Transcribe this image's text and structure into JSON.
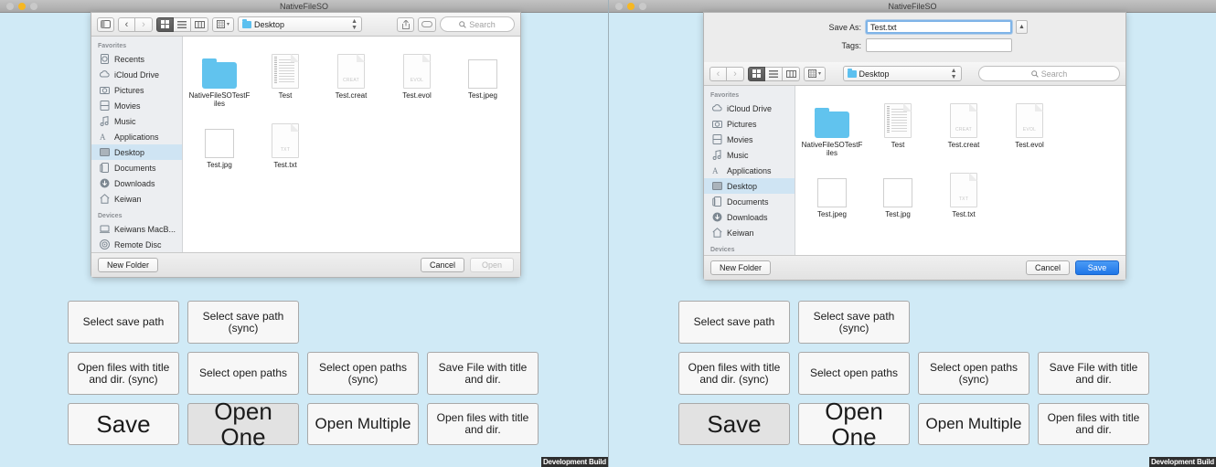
{
  "window_title": "NativeFileSO",
  "colors": {
    "background": "#d0eaf6",
    "accent": "#1f76e8",
    "selection": "#cfe4f3"
  },
  "traffic_lights": [
    "close",
    "minimize",
    "zoom"
  ],
  "watermark": "Development Build",
  "open_dialog": {
    "toolbar": {
      "sidebar_toggle": "sidebar-toggle-icon",
      "back": "‹",
      "forward": "›",
      "view_icon": "grid-view-icon",
      "view_list": "list-view-icon",
      "view_column": "column-view-icon",
      "group_by": "group-by-icon",
      "path_label": "Desktop",
      "share": "share-icon",
      "tag": "tag-icon",
      "search_placeholder": "Search"
    },
    "sidebar": {
      "favorites_header": "Favorites",
      "favorites": [
        {
          "label": "Recents",
          "icon": "clock-icon",
          "selected": false
        },
        {
          "label": "iCloud Drive",
          "icon": "cloud-icon",
          "selected": false
        },
        {
          "label": "Pictures",
          "icon": "camera-icon",
          "selected": false
        },
        {
          "label": "Movies",
          "icon": "film-icon",
          "selected": false
        },
        {
          "label": "Music",
          "icon": "note-icon",
          "selected": false
        },
        {
          "label": "Applications",
          "icon": "apps-icon",
          "selected": false
        },
        {
          "label": "Desktop",
          "icon": "desktop-icon",
          "selected": true
        },
        {
          "label": "Documents",
          "icon": "documents-icon",
          "selected": false
        },
        {
          "label": "Downloads",
          "icon": "download-icon",
          "selected": false
        },
        {
          "label": "Keiwan",
          "icon": "home-icon",
          "selected": false
        }
      ],
      "devices_header": "Devices",
      "devices": [
        {
          "label": "Keiwans MacB...",
          "icon": "laptop-icon"
        },
        {
          "label": "Remote Disc",
          "icon": "disc-icon"
        }
      ]
    },
    "files": [
      {
        "name": "NativeFileSOTestFiles",
        "type": "folder"
      },
      {
        "name": "Test",
        "type": "doc-lined"
      },
      {
        "name": "Test.creat",
        "type": "doc",
        "tag": "CREAT"
      },
      {
        "name": "Test.evol",
        "type": "doc",
        "tag": "EVOL"
      },
      {
        "name": "Test.jpeg",
        "type": "image",
        "bg": "#0a0a0a"
      },
      {
        "name": "Test.jpg",
        "type": "image",
        "bg": "#0a0a0a"
      },
      {
        "name": "Test.txt",
        "type": "doc",
        "tag": "TXT"
      }
    ],
    "footer": {
      "new_folder": "New Folder",
      "cancel": "Cancel",
      "confirm": "Open",
      "confirm_disabled": true
    }
  },
  "save_dialog": {
    "save_as_label": "Save As:",
    "save_as_value": "Test.txt",
    "tags_label": "Tags:",
    "tags_value": "",
    "toolbar": {
      "back": "‹",
      "forward": "›",
      "view_icon": "grid-view-icon",
      "view_list": "list-view-icon",
      "view_column": "column-view-icon",
      "group_by": "group-by-icon",
      "path_label": "Desktop",
      "search_placeholder": "Search"
    },
    "sidebar": {
      "favorites_header": "Favorites",
      "favorites": [
        {
          "label": "iCloud Drive",
          "icon": "cloud-icon",
          "selected": false
        },
        {
          "label": "Pictures",
          "icon": "camera-icon",
          "selected": false
        },
        {
          "label": "Movies",
          "icon": "film-icon",
          "selected": false
        },
        {
          "label": "Music",
          "icon": "note-icon",
          "selected": false
        },
        {
          "label": "Applications",
          "icon": "apps-icon",
          "selected": false
        },
        {
          "label": "Desktop",
          "icon": "desktop-icon",
          "selected": true
        },
        {
          "label": "Documents",
          "icon": "documents-icon",
          "selected": false
        },
        {
          "label": "Downloads",
          "icon": "download-icon",
          "selected": false
        },
        {
          "label": "Keiwan",
          "icon": "home-icon",
          "selected": false
        }
      ],
      "devices_header": "Devices",
      "devices": []
    },
    "files": [
      {
        "name": "NativeFileSOTestFiles",
        "type": "folder"
      },
      {
        "name": "Test",
        "type": "doc-lined"
      },
      {
        "name": "Test.creat",
        "type": "doc",
        "tag": "CREAT"
      },
      {
        "name": "Test.evol",
        "type": "doc",
        "tag": "EVOL"
      },
      {
        "name": "Test.jpeg",
        "type": "image",
        "bg": "#8e8e8e"
      },
      {
        "name": "Test.jpg",
        "type": "image",
        "bg": "#8e8e8e"
      },
      {
        "name": "Test.txt",
        "type": "doc",
        "tag": "TXT"
      }
    ],
    "footer": {
      "new_folder": "New Folder",
      "cancel": "Cancel",
      "confirm": "Save",
      "confirm_primary": true
    }
  },
  "app_buttons": {
    "left_highlight": "Open One",
    "right_highlight": "Save",
    "rows": [
      [
        {
          "label": "Select save path",
          "size": "normal"
        },
        {
          "label": "Select save path (sync)",
          "size": "normal"
        }
      ],
      [
        {
          "label": "Open files with title and dir. (sync)",
          "size": "normal"
        },
        {
          "label": "Select open paths",
          "size": "normal"
        },
        {
          "label": "Select open paths (sync)",
          "size": "normal"
        },
        {
          "label": "Save File with title and dir.",
          "size": "normal"
        }
      ],
      [
        {
          "label": "Save",
          "size": "big"
        },
        {
          "label": "Open One",
          "size": "big"
        },
        {
          "label": "Open Multiple",
          "size": "mid"
        },
        {
          "label": "Open files with title and dir.",
          "size": "normal"
        }
      ]
    ]
  }
}
